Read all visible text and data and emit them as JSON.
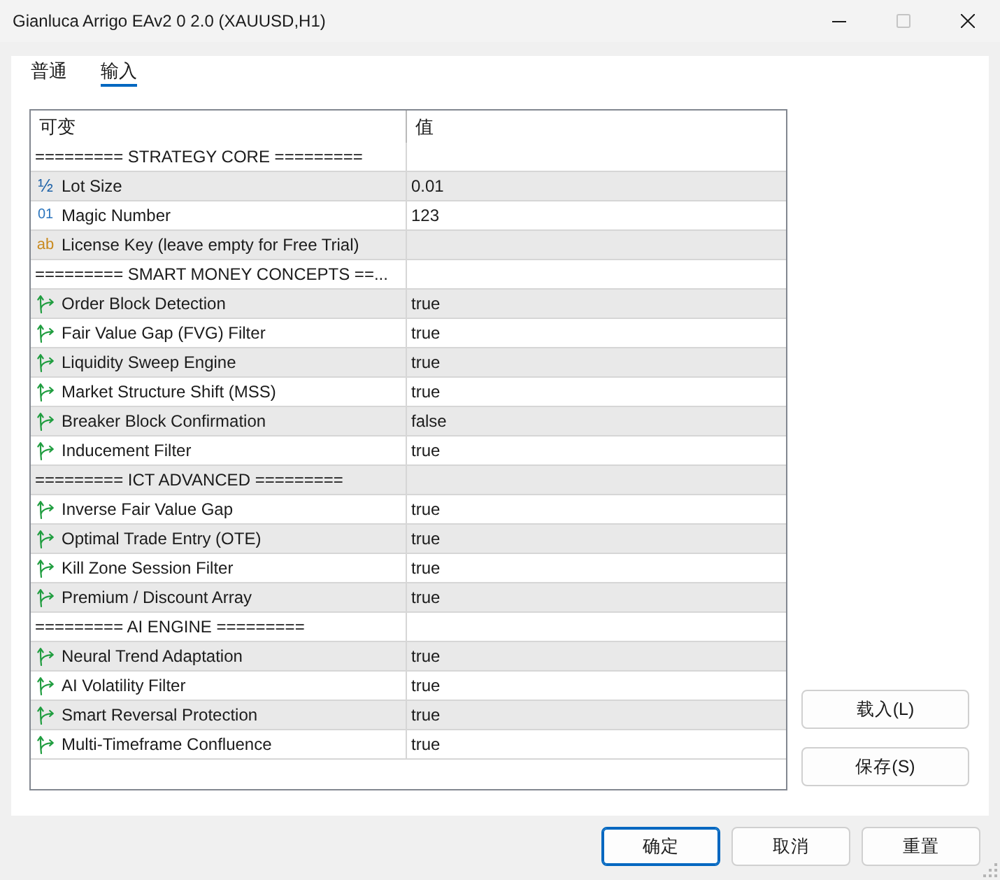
{
  "window": {
    "title": "Gianluca Arrigo EAv2 0 2.0 (XAUUSD,H1)"
  },
  "tabs": [
    {
      "label": "普通",
      "selected": false
    },
    {
      "label": "输入",
      "selected": true
    }
  ],
  "table": {
    "columns": [
      "可变",
      "值"
    ],
    "rows": [
      {
        "kind": "separator",
        "name": "========= STRATEGY CORE ========="
      },
      {
        "kind": "double",
        "icon": "½",
        "name": "Lot Size",
        "value": "0.01"
      },
      {
        "kind": "int",
        "icon": "01",
        "name": "Magic Number",
        "value": "123"
      },
      {
        "kind": "string",
        "icon": "ab",
        "name": "License Key (leave empty for Free Trial)"
      },
      {
        "kind": "separator",
        "name": "========= SMART MONEY CONCEPTS ==..."
      },
      {
        "kind": "bool",
        "name": "Order Block Detection",
        "value": "true"
      },
      {
        "kind": "bool",
        "name": "Fair Value Gap (FVG) Filter",
        "value": "true"
      },
      {
        "kind": "bool",
        "name": "Liquidity Sweep Engine",
        "value": "true"
      },
      {
        "kind": "bool",
        "name": "Market Structure Shift (MSS)",
        "value": "true"
      },
      {
        "kind": "bool",
        "name": "Breaker Block Confirmation",
        "value": "false"
      },
      {
        "kind": "bool",
        "name": "Inducement Filter",
        "value": "true"
      },
      {
        "kind": "separator",
        "name": "========= ICT ADVANCED ========="
      },
      {
        "kind": "bool",
        "name": "Inverse Fair Value Gap",
        "value": "true"
      },
      {
        "kind": "bool",
        "name": "Optimal Trade Entry (OTE)",
        "value": "true"
      },
      {
        "kind": "bool",
        "name": "Kill Zone Session Filter",
        "value": "true"
      },
      {
        "kind": "bool",
        "name": "Premium / Discount Array",
        "value": "true"
      },
      {
        "kind": "separator",
        "name": "========= AI ENGINE ========="
      },
      {
        "kind": "bool",
        "name": "Neural Trend Adaptation",
        "value": "true"
      },
      {
        "kind": "bool",
        "name": "AI Volatility Filter",
        "value": "true"
      },
      {
        "kind": "bool",
        "name": "Smart Reversal Protection",
        "value": "true"
      },
      {
        "kind": "bool",
        "name": "Multi-Timeframe Confluence",
        "value": "true"
      }
    ]
  },
  "side_buttons": [
    "载入(L)",
    "保存(S)"
  ],
  "buttons": [
    {
      "label": "确定",
      "default": true
    },
    {
      "label": "取消",
      "default": false
    },
    {
      "label": "重置",
      "default": false
    }
  ]
}
